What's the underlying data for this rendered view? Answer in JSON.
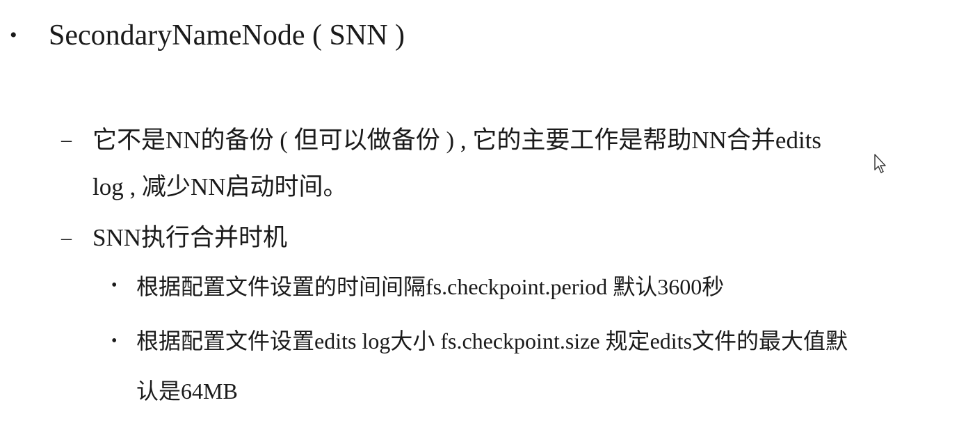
{
  "slide": {
    "heading_bullet": "•",
    "heading": "SecondaryNameNode ( SNN )",
    "items": [
      {
        "marker": "–",
        "line1": "它不是NN的备份 ( 但可以做备份 ) , 它的主要工作是帮助NN合并edits",
        "line2": "log , 减少NN启动时间。"
      },
      {
        "marker": "–",
        "line1": "SNN执行合并时机",
        "subitems": [
          {
            "marker": "•",
            "line1": "根据配置文件设置的时间间隔fs.checkpoint.period  默认3600秒"
          },
          {
            "marker": "•",
            "line1": "根据配置文件设置edits log大小 fs.checkpoint.size 规定edits文件的最大值默",
            "line2": "认是64MB"
          }
        ]
      }
    ]
  },
  "cursor": {
    "icon": "mouse-pointer-icon"
  }
}
